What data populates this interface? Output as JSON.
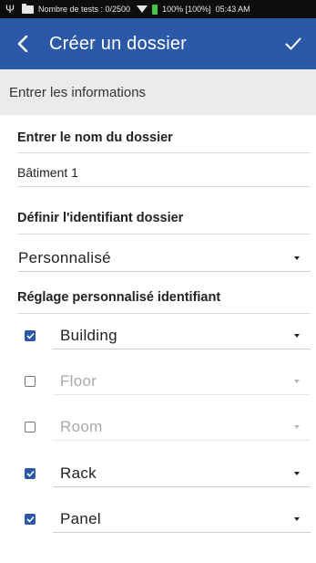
{
  "status_bar": {
    "usb_icon": "usb-icon",
    "folder_icon": "folder-icon",
    "tests_text": "Nombre de tests : 0/2500",
    "wifi_icon": "wifi-icon",
    "battery_icon": "battery-icon",
    "battery_text": "100% [100%]",
    "time": "05:43 AM"
  },
  "app_bar": {
    "back_icon": "chevron-left-icon",
    "title": "Créer un dossier",
    "confirm_icon": "check-icon",
    "color": "#2b59a7"
  },
  "section_header": "Entrer les informations",
  "folder_name": {
    "label": "Entrer le nom du dossier",
    "value": "Bâtiment 1"
  },
  "identifier": {
    "label": "Définir l'identifiant dossier",
    "selected": "Personnalisé"
  },
  "custom": {
    "label": "Réglage personnalisé identifiant",
    "rows": [
      {
        "checked": true,
        "value": "Building"
      },
      {
        "checked": false,
        "value": "Floor"
      },
      {
        "checked": false,
        "value": "Room"
      },
      {
        "checked": true,
        "value": "Rack"
      },
      {
        "checked": true,
        "value": "Panel"
      }
    ]
  }
}
